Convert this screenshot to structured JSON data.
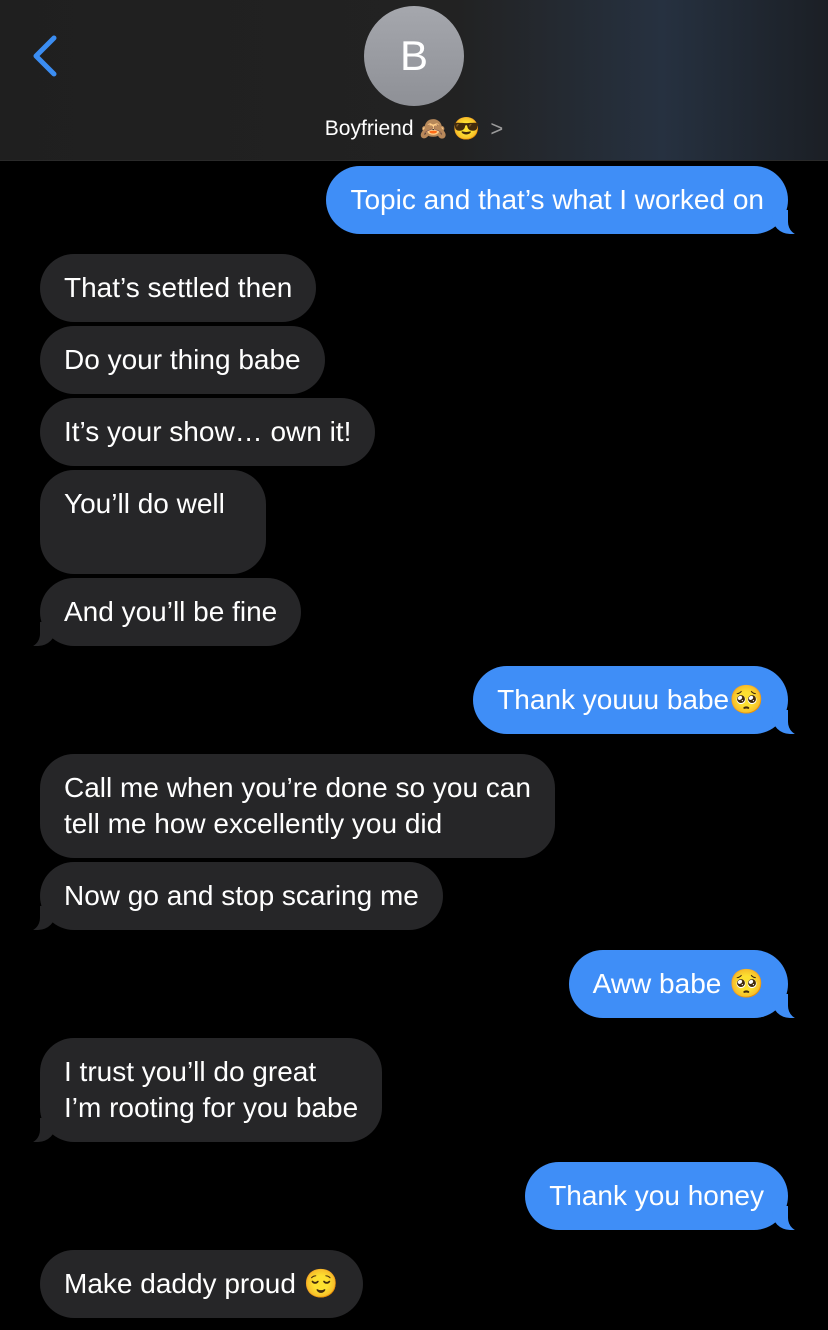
{
  "header": {
    "avatar_initial": "B",
    "contact_name": "Boyfriend",
    "contact_emoji_1": "🙈",
    "contact_emoji_2": "😎",
    "chevron": ">"
  },
  "messages": [
    {
      "from": "me",
      "text": "Topic and that’s what I worked on"
    },
    {
      "from": "them",
      "text": "That’s settled then"
    },
    {
      "from": "them",
      "text": "Do your thing babe"
    },
    {
      "from": "them",
      "text": "It’s your show… own it!"
    },
    {
      "from": "them",
      "text": "You’ll do well"
    },
    {
      "from": "them",
      "text": "And you’ll be fine"
    },
    {
      "from": "me",
      "text": "Thank youuu babe",
      "emoji": "🥺"
    },
    {
      "from": "them",
      "line1": "Call me when you’re done so you can",
      "line2": "tell me how excellently you did"
    },
    {
      "from": "them",
      "text": "Now go and stop scaring me"
    },
    {
      "from": "me",
      "text": "Aww babe ",
      "emoji": "🥺"
    },
    {
      "from": "them",
      "line1": "I trust you’ll do great",
      "line2": "I’m rooting for you babe"
    },
    {
      "from": "me",
      "text": "Thank you honey"
    },
    {
      "from": "them",
      "text": "Make daddy proud ",
      "emoji": "😌"
    }
  ],
  "colors": {
    "incoming": "#262628",
    "outgoing": "#3f8ef7",
    "accent": "#3b8df2"
  }
}
